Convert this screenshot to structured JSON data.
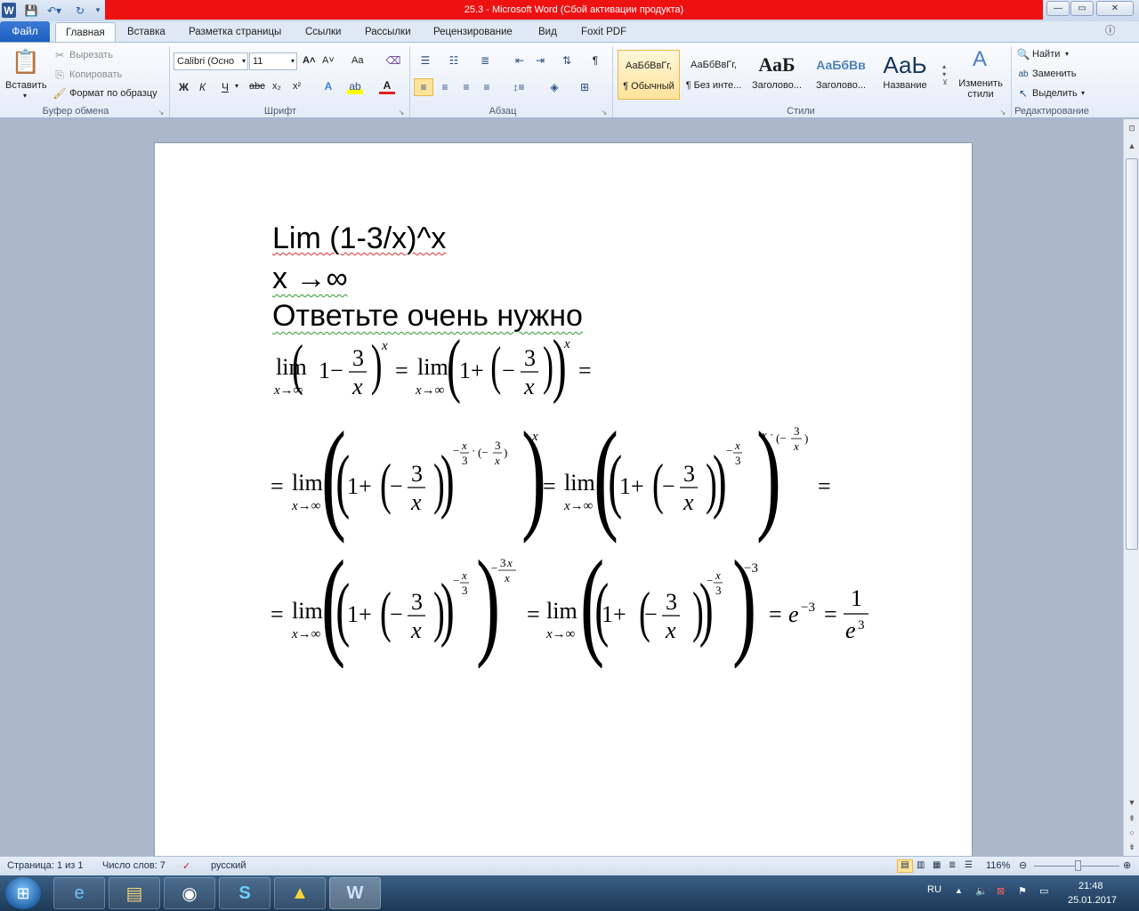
{
  "window": {
    "title": "25.3  -  Microsoft Word (Сбой активации продукта)",
    "word_icon": "W",
    "minimize": "—",
    "maximize": "▭",
    "close": "✕"
  },
  "tabs": {
    "file": "Файл",
    "items": [
      "Главная",
      "Вставка",
      "Разметка страницы",
      "Ссылки",
      "Рассылки",
      "Рецензирование",
      "Вид",
      "Foxit PDF"
    ],
    "active": "Главная"
  },
  "ribbon": {
    "clipboard": {
      "paste": "Вставить",
      "cut": "Вырезать",
      "copy": "Копировать",
      "format_painter": "Формат по образцу",
      "label": "Буфер обмена"
    },
    "font": {
      "font_name": "Calibri (Осно",
      "font_size": "11",
      "bold": "Ж",
      "italic": "К",
      "underline": "Ч",
      "strike": "abc",
      "sub": "x₂",
      "sup": "x²",
      "grow": "A˄",
      "shrink": "A˅",
      "case": "Aa",
      "label": "Шрифт"
    },
    "paragraph": {
      "label": "Абзац",
      "pilcrow": "¶"
    },
    "styles": {
      "items": [
        {
          "sample": "АаБбВвГг,",
          "name": "¶ Обычный"
        },
        {
          "sample": "АаБбВвГг,",
          "name": "¶ Без инте..."
        },
        {
          "sample": "АаБ",
          "name": "Заголово..."
        },
        {
          "sample": "АаБбВв",
          "name": "Заголово..."
        },
        {
          "sample": "АаЬ",
          "name": "Название"
        }
      ],
      "change_styles": "Изменить стили",
      "label": "Стили"
    },
    "editing": {
      "find": "Найти",
      "replace": "Заменить",
      "select": "Выделить",
      "label": "Редактирование"
    }
  },
  "document": {
    "line1": "Lim (1-3/x)^x",
    "line2": "x →∞",
    "line3": "Ответьте очень нужно"
  },
  "status": {
    "page": "Страница: 1 из 1",
    "words": "Число слов: 7",
    "language": "русский",
    "zoom": "116%"
  },
  "taskbar": {
    "lang": "RU",
    "time": "21:48",
    "date": "25.01.2017"
  }
}
